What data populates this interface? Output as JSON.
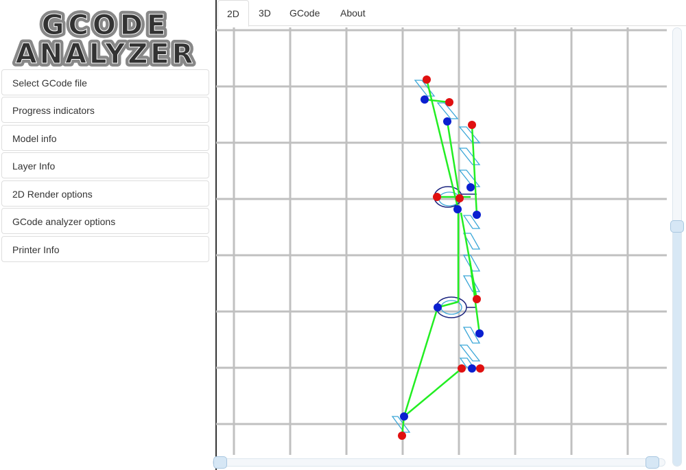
{
  "logo": {
    "line1": "GCODE",
    "line2": "ANALYZER"
  },
  "sidebar": {
    "items": [
      {
        "label": "Select GCode file"
      },
      {
        "label": "Progress indicators"
      },
      {
        "label": "Model info"
      },
      {
        "label": "Layer Info"
      },
      {
        "label": "2D Render options"
      },
      {
        "label": "GCode analyzer options"
      },
      {
        "label": "Printer Info"
      }
    ]
  },
  "tabs": [
    {
      "label": "2D",
      "active": true
    },
    {
      "label": "3D"
    },
    {
      "label": "GCode"
    },
    {
      "label": "About"
    }
  ],
  "colors": {
    "grid": "#c0c0c0",
    "extrusion": "#22ee22",
    "perimeter": "#3aa6d8",
    "retract": "#e01010",
    "restart": "#0a1fd0",
    "loop": "#1a237e"
  },
  "layer_slider": {
    "value_fraction": 0.55
  },
  "range_slider": {
    "start_fraction": 0,
    "end_fraction": 1
  }
}
